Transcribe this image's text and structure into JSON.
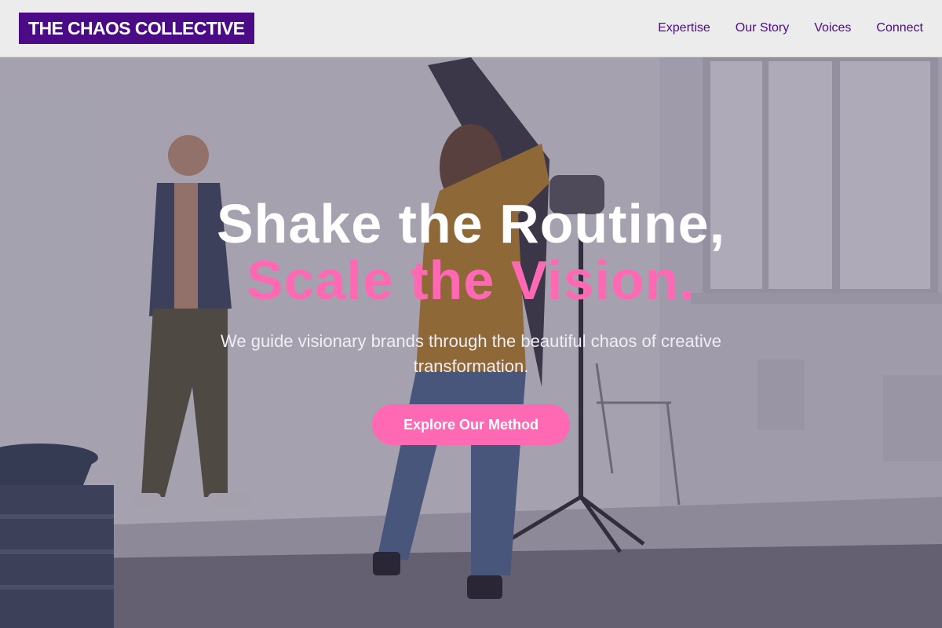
{
  "brand": {
    "name": "THE CHAOS COLLECTIVE",
    "color": "#4b0a86"
  },
  "nav": {
    "items": [
      "Expertise",
      "Our Story",
      "Voices",
      "Connect"
    ]
  },
  "hero": {
    "headline_line1": "Shake the Routine,",
    "headline_line2": "Scale the Vision.",
    "subtitle": "We guide visionary brands through the beautiful chaos of creative transformation.",
    "cta_label": "Explore Our Method",
    "accent_color": "#ff69b4"
  }
}
